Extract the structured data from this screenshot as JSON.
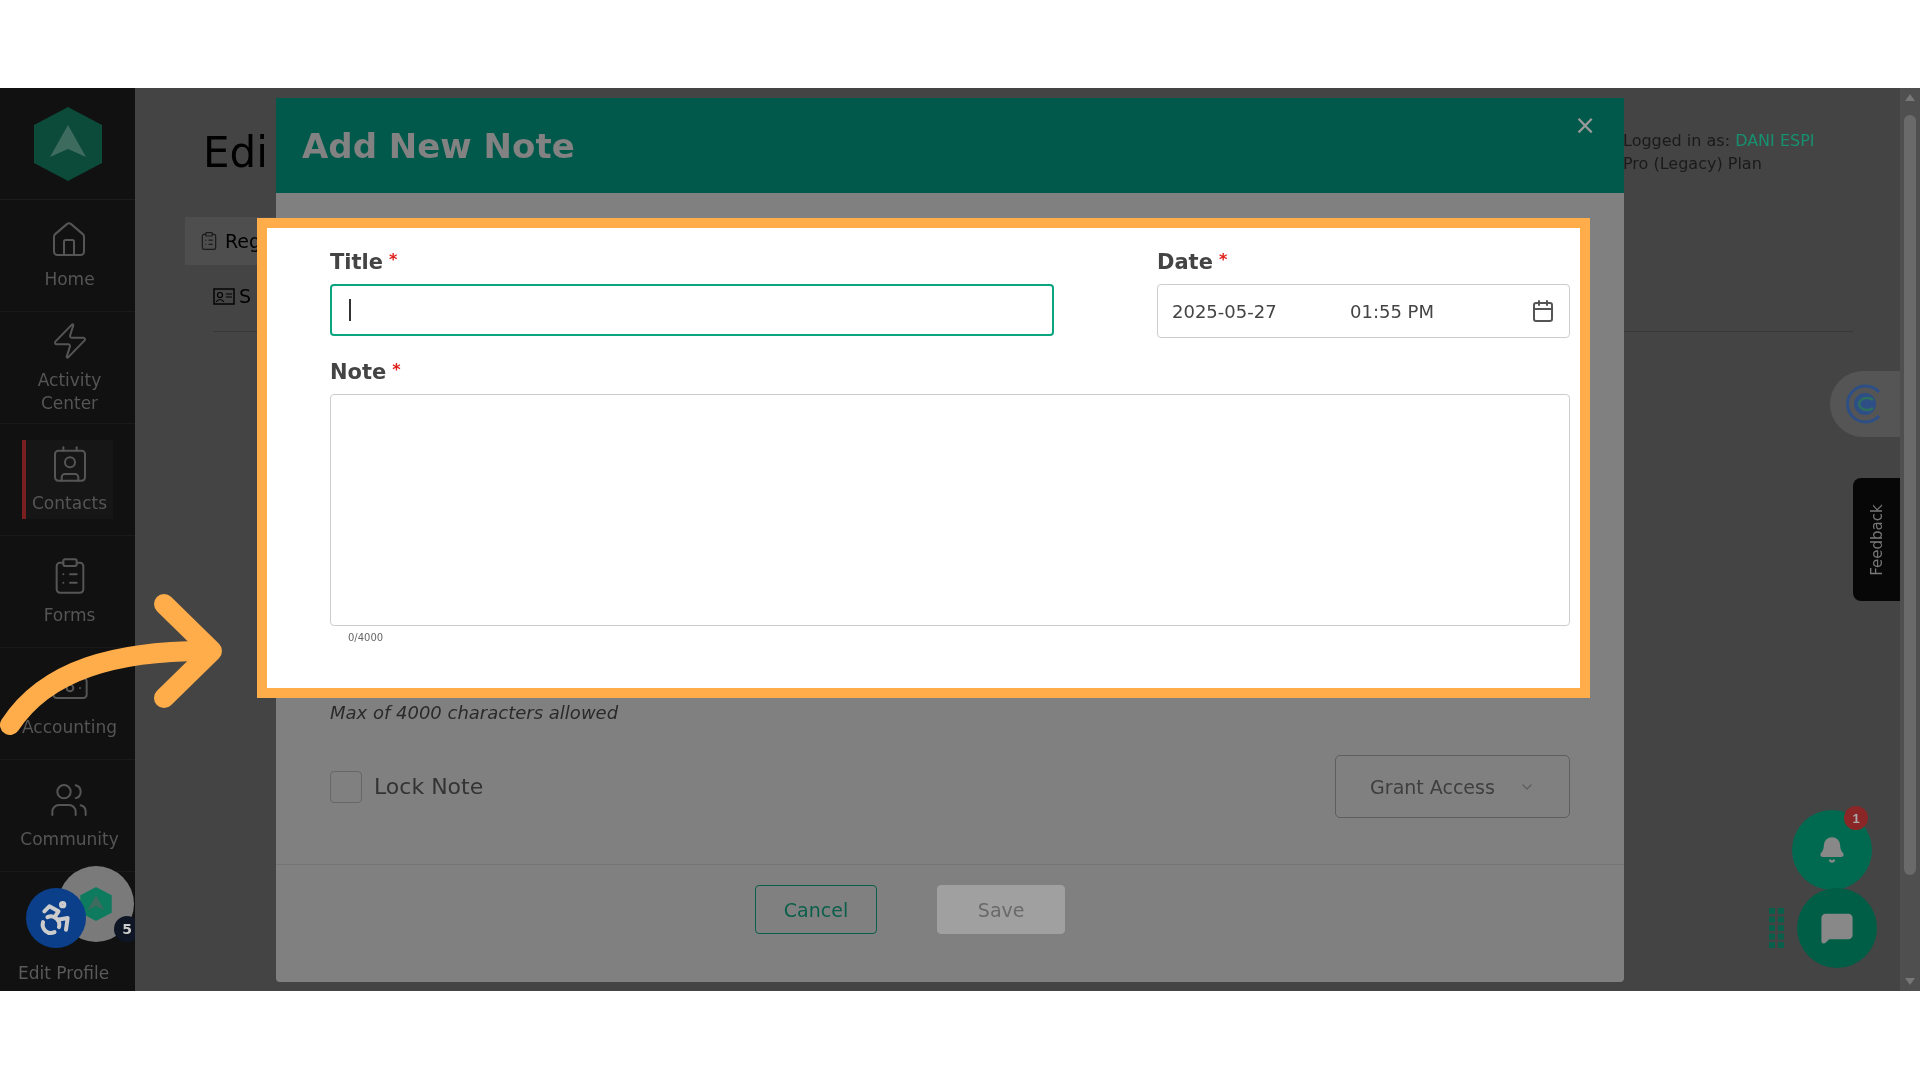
{
  "sidebar": {
    "items": [
      {
        "label": "Home",
        "selected": false
      },
      {
        "label": "Activity Center",
        "selected": false
      },
      {
        "label": "Contacts",
        "selected": true
      },
      {
        "label": "Forms",
        "selected": false
      },
      {
        "label": "Accounting",
        "selected": false
      },
      {
        "label": "Community",
        "selected": false
      }
    ],
    "profile_label": "Edit Profile",
    "avatar_badge": "5"
  },
  "page": {
    "title": "Edi",
    "tab": "Reg",
    "subtab": "S"
  },
  "account": {
    "prefix": "Logged in as:",
    "user": "DANI ESPI",
    "plan": "Pro (Legacy) Plan"
  },
  "feedback_tab": "Feedback",
  "notifications": {
    "count": "1"
  },
  "modal": {
    "title": "Add New Note",
    "close": "×",
    "title_field": {
      "label": "Title",
      "required_mark": "*",
      "focused": true
    },
    "date_field": {
      "label": "Date",
      "required_mark": "*",
      "date": "2025-05-27",
      "time": "01:55 PM"
    },
    "note_field": {
      "label": "Note",
      "required_mark": "*",
      "counter": "0/4000"
    },
    "hint": "Max of 4000 characters allowed",
    "lock_note": {
      "label": "Lock Note",
      "checked": false
    },
    "grant_access": "Grant Access",
    "buttons": [
      {
        "label": "Cancel",
        "disabled": false
      },
      {
        "label": "Save",
        "disabled": true
      }
    ]
  }
}
